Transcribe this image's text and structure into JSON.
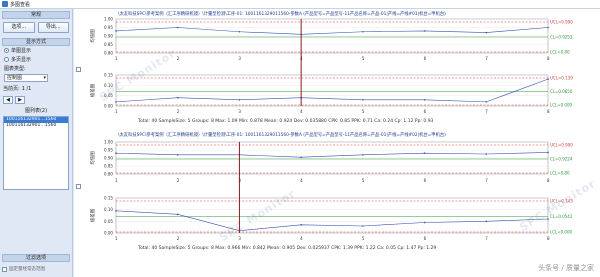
{
  "window": {
    "title": "多图查看"
  },
  "sidebar": {
    "section_general": "常规",
    "select_button": "选项...",
    "export_button": "导出...",
    "section_display": "显示方式",
    "radio_single": "单图显示",
    "radio_multi": "多页显示",
    "chart_type_label": "图表类型:",
    "chart_type_value": "控制图",
    "page_label": "当前页:",
    "page_value": "1 /1",
    "list_label": "图列表(2)",
    "list_items": [
      "100116132901…1560",
      "100116132901…1560"
    ],
    "filter_header": "过滤选项",
    "fixed_ctrl_label": "固定量经常态范围"
  },
  "colors": {
    "accent": "#3a7bd5",
    "ucl": "#d23b3b",
    "cl": "#2a9a34",
    "series": "#3a4fb0",
    "cursor": "#8b1c1c"
  },
  "charts": [
    {
      "title": "\\太友科技SPC\\参考案例（汇工序精研机镜）\\计量型检测\\工序-01: 1001161329011560-参数A       (产品型号=产品型号-11产品名称=产品-01|产线=产线#01|机台=甲机台)",
      "top_ylabel": "均值图",
      "bot_ylabel": "极差图",
      "top_ticks": [
        "1.00",
        "0.95",
        "0.90",
        "0.85",
        "0.80"
      ],
      "bot_ticks": [
        "0.15",
        "0.10",
        "0.05",
        "0.00"
      ],
      "x_labels": [
        "1",
        "2",
        "3",
        "4",
        "5",
        "6",
        "7",
        "8"
      ],
      "top_limits": {
        "ucl": "UCL=0.990",
        "cl": "CL=0.9253",
        "lcl": "LCL=0.80"
      },
      "bot_limits": {
        "ucl": "UCL=0.139",
        "cl": "CL=0.0650",
        "lcl": "LCL=0.000"
      },
      "stats": "Total: 40   SampleSize: 5   Groups: 8   Max: 1.09   Min: 0.878   Mean: 0.924   Dev: 0.035880   CPK: 0.85   PPK: 0.71   Ca: 0.24   Cp: 1.12   Pp: 0.93"
    },
    {
      "title": "\\太友科技SPC\\参考案例（汇工序精研机镜）\\计量型检测\\工序-01: 1001161329011560-参数A       (产品型号=产品型号-11产品名称=产品-01|产线=产线#02|机台=甲机台)",
      "top_ylabel": "均值图",
      "bot_ylabel": "极差图",
      "top_ticks": [
        "1.00",
        "0.95",
        "0.90",
        "0.85",
        "0.80"
      ],
      "bot_ticks": [
        "0.15",
        "0.10",
        "0.05",
        "0.00"
      ],
      "x_labels": [
        "1",
        "2",
        "3",
        "4",
        "5",
        "6",
        "7",
        "8"
      ],
      "top_limits": {
        "ucl": "UCL=0.990",
        "cl": "CL=0.9224",
        "lcl": "LCL=0.80"
      },
      "bot_limits": {
        "ucl": "UCL=0.143",
        "cl": "CL=0.0542",
        "lcl": "LCL=0.000"
      },
      "stats": "Total: 40   SampleSize: 5   Groups: 8   Max: 0.966   Min: 0.842   Mean: 0.905   Dev: 0.025937   CPK: 1.39   PPK: 1.22   Ca: 0.05   Cp: 1.47   Pp: 1.29"
    }
  ],
  "chart_data": [
    {
      "type": "line",
      "x": [
        1,
        2,
        3,
        4,
        5,
        6,
        7,
        8
      ],
      "series": [
        {
          "values": [
            0.93,
            0.95,
            0.925,
            0.91,
            0.925,
            0.93,
            0.92,
            0.95
          ]
        },
        {
          "values": [
            0.02,
            0.04,
            0.03,
            0.04,
            0.03,
            0.03,
            0.02,
            0.13
          ]
        }
      ],
      "ylim_top": [
        0.8,
        1.0
      ],
      "ylim_bottom": [
        0,
        0.15
      ]
    },
    {
      "type": "line",
      "x": [
        1,
        2,
        3,
        4,
        5,
        6,
        7,
        8
      ],
      "series": [
        {
          "values": [
            0.93,
            0.92,
            0.92,
            0.905,
            0.92,
            0.93,
            0.925,
            0.935
          ]
        },
        {
          "values": [
            0.095,
            0.08,
            0.01,
            0.035,
            0.03,
            0.045,
            0.05,
            0.06
          ]
        }
      ],
      "ylim_top": [
        0.8,
        1.0
      ],
      "ylim_bottom": [
        0,
        0.15
      ]
    }
  ],
  "watermark": "SPC Monitor",
  "brand": "头条号 / 质量之家"
}
